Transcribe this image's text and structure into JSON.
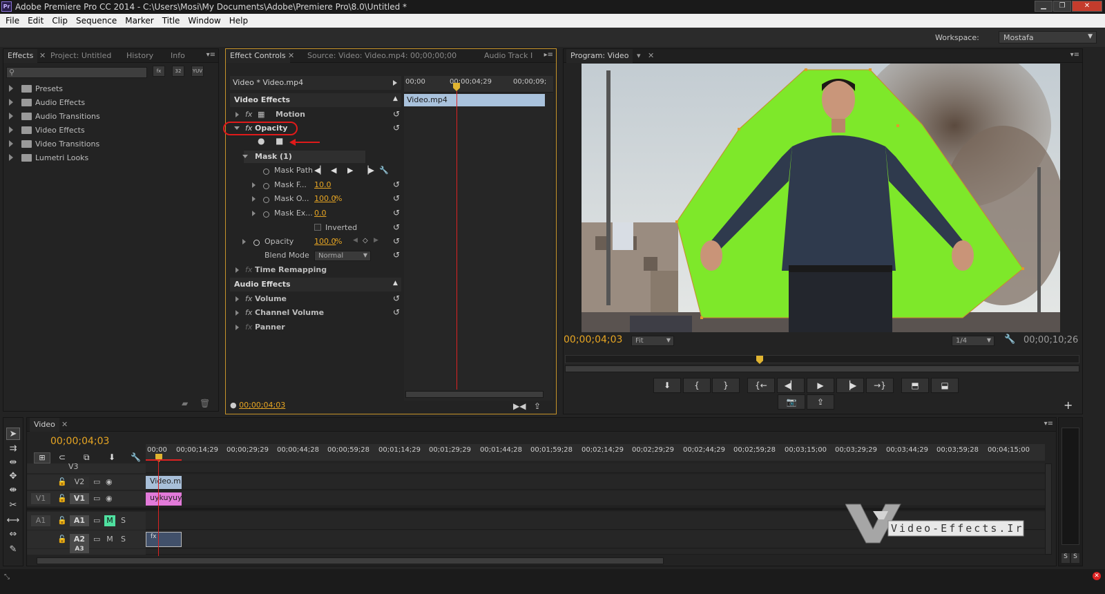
{
  "window": {
    "title": "Adobe Premiere Pro CC 2014 - C:\\Users\\Mosi\\My Documents\\Adobe\\Premiere Pro\\8.0\\Untitled *",
    "app_icon": "Pr"
  },
  "menu": [
    "File",
    "Edit",
    "Clip",
    "Sequence",
    "Marker",
    "Title",
    "Window",
    "Help"
  ],
  "workspace": {
    "label": "Workspace:",
    "value": "Mostafa"
  },
  "left_panel": {
    "tabs": [
      "Effects",
      "Project: Untitled",
      "History",
      "Info"
    ],
    "tool_buttons": [
      "fx",
      "32",
      "YUV"
    ],
    "bins": [
      "Presets",
      "Audio Effects",
      "Audio Transitions",
      "Video Effects",
      "Video Transitions",
      "Lumetri Looks"
    ]
  },
  "effect_controls": {
    "tabs": [
      "Effect Controls",
      "Source: Video: Video.mp4: 00;00;00;00",
      "Audio Track I"
    ],
    "clip_path": "Video * Video.mp4",
    "ruler_ticks": [
      "00;00",
      "00;00;04;29",
      "00;00;09;"
    ],
    "clip_name": "Video.mp4",
    "sections": {
      "video_effects": "Video Effects",
      "audio_effects": "Audio Effects"
    },
    "effects": {
      "motion": "Motion",
      "opacity": "Opacity",
      "mask": "Mask (1)",
      "mask_path": "Mask Path",
      "mask_feather_label": "Mask F...",
      "mask_feather_value": "10.0",
      "mask_opacity_label": "Mask O...",
      "mask_opacity_value": "100.0",
      "mask_opacity_unit": "%",
      "mask_expansion_label": "Mask Ex...",
      "mask_expansion_value": "0.0",
      "inverted": "Inverted",
      "opacity_param": "Opacity",
      "opacity_value": "100.0",
      "opacity_unit": "%",
      "blend_mode_label": "Blend Mode",
      "blend_mode_value": "Normal",
      "time_remapping": "Time Remapping",
      "volume": "Volume",
      "channel_volume": "Channel Volume",
      "panner": "Panner"
    },
    "timecode": "00;00;04;03"
  },
  "program_monitor": {
    "tab": "Program: Video",
    "timecode_current": "00;00;04;03",
    "fit": "Fit",
    "resolution": "1/4",
    "timecode_duration": "00;00;10;26"
  },
  "timeline": {
    "tab": "Video",
    "timecode": "00;00;04;03",
    "ruler": [
      "00;00",
      "00;00;14;29",
      "00;00;29;29",
      "00;00;44;28",
      "00;00;59;28",
      "00;01;14;29",
      "00;01;29;29",
      "00;01;44;28",
      "00;01;59;28",
      "00;02;14;29",
      "00;02;29;29",
      "00;02;44;29",
      "00;02;59;28",
      "00;03;15;00",
      "00;03;29;29",
      "00;03;44;29",
      "00;03;59;28",
      "00;04;15;00"
    ],
    "tracks": {
      "v3": "V3",
      "v2": "V2",
      "v1_src": "V1",
      "v1": "V1",
      "a1_src": "A1",
      "a1": "A1",
      "a2": "A2",
      "a3": "A3",
      "m": "M",
      "s": "S"
    },
    "clips": {
      "v2": "Video.m",
      "v1": "uykuyuy",
      "a2": "fx"
    }
  },
  "audio_meter": {
    "solo": [
      "S",
      "S"
    ]
  },
  "watermark": {
    "text": "Video-Effects.Ir"
  },
  "colors": {
    "accent": "#e8a623",
    "annotation_red": "#e01a1a",
    "clip_blue": "#a9c2dc",
    "clip_pink": "#e27ad9",
    "green_screen": "#7ee82a"
  }
}
